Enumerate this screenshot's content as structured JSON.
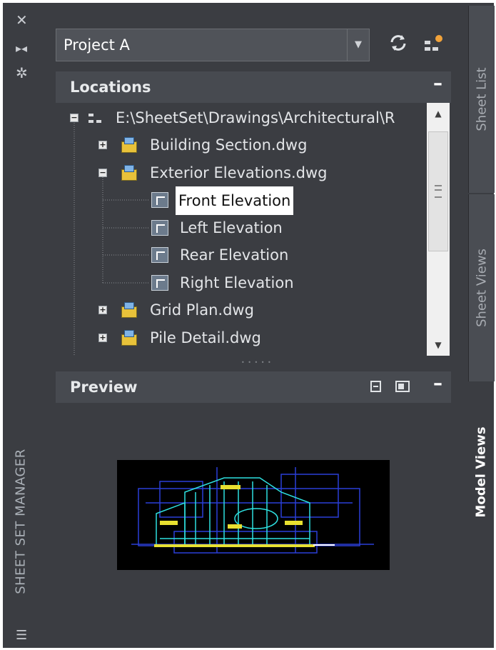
{
  "palette": {
    "title": "SHEET SET MANAGER",
    "title_bar_icons": [
      "close-icon",
      "auto-hide-icon",
      "properties-icon",
      "menu-icon"
    ]
  },
  "selector": {
    "value": "Project A"
  },
  "toolbar_icons": [
    "refresh-icon",
    "sheet-set-icon"
  ],
  "locations": {
    "title": "Locations",
    "collapse": "–",
    "tree": [
      {
        "label": "E:\\SheetSet\\Drawings\\Architectural\\R",
        "level": 0,
        "expander": "−",
        "icon": "location-icon",
        "selected": false
      },
      {
        "label": "Building Section.dwg",
        "level": 1,
        "expander": "+",
        "icon": "drawing-icon",
        "selected": false
      },
      {
        "label": "Exterior Elevations.dwg",
        "level": 1,
        "expander": "−",
        "icon": "drawing-icon",
        "selected": false
      },
      {
        "label": "Front Elevation",
        "level": 2,
        "expander": "",
        "icon": "view-icon",
        "selected": true
      },
      {
        "label": "Left Elevation",
        "level": 2,
        "expander": "",
        "icon": "view-icon",
        "selected": false
      },
      {
        "label": "Rear Elevation",
        "level": 2,
        "expander": "",
        "icon": "view-icon",
        "selected": false
      },
      {
        "label": "Right Elevation",
        "level": 2,
        "expander": "",
        "icon": "view-icon",
        "selected": false
      },
      {
        "label": "Grid Plan.dwg",
        "level": 1,
        "expander": "+",
        "icon": "drawing-icon",
        "selected": false
      },
      {
        "label": "Pile Detail.dwg",
        "level": 1,
        "expander": "+",
        "icon": "drawing-icon",
        "selected": false
      }
    ]
  },
  "preview": {
    "title": "Preview",
    "collapse": "–",
    "header_icons": [
      "preview-icon",
      "details-icon"
    ]
  },
  "tabs": [
    {
      "label": "Sheet List",
      "active": false
    },
    {
      "label": "Sheet Views",
      "active": false
    },
    {
      "label": "Model Views",
      "active": true
    }
  ]
}
